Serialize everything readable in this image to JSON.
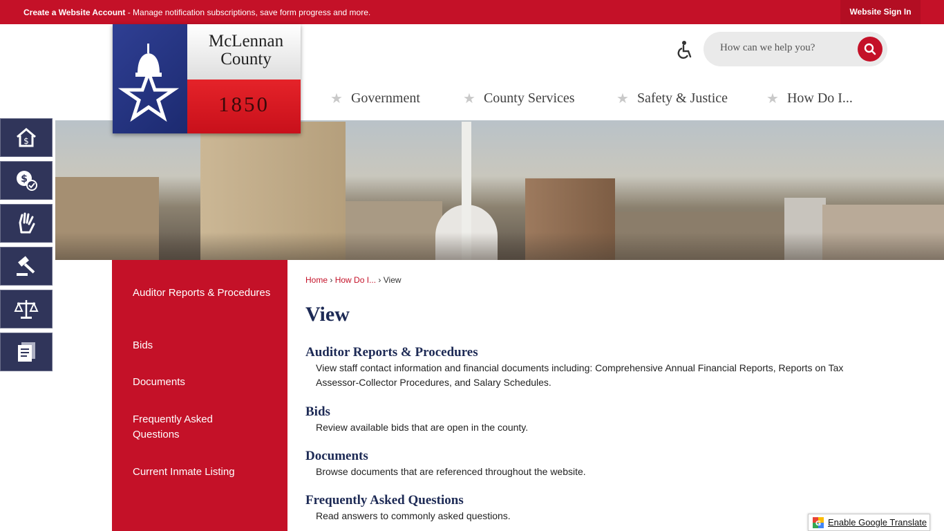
{
  "topbar": {
    "account_link": "Create a Website Account",
    "account_desc": " - Manage notification subscriptions, save form progress and more.",
    "signin": "Website Sign In"
  },
  "logo": {
    "name_line1": "McLennan",
    "name_line2": "County",
    "year": "1850"
  },
  "search": {
    "placeholder": "How can we help you?"
  },
  "nav": [
    "Government",
    "County Services",
    "Safety & Justice",
    "How Do I..."
  ],
  "quick_links_icons": [
    "home-dollar-icon",
    "money-check-icon",
    "helping-hand-icon",
    "gavel-icon",
    "scales-icon",
    "documents-icon"
  ],
  "leftnav": [
    "Auditor Reports & Procedures",
    "Bids",
    "Documents",
    "Frequently Asked Questions",
    "Current Inmate Listing"
  ],
  "breadcrumb": {
    "home": "Home",
    "parent": "How Do I...",
    "current": "View",
    "sep": "›"
  },
  "page_title": "View",
  "entries": [
    {
      "title": "Auditor Reports & Procedures",
      "desc": "View staff contact information and financial documents including: Comprehensive Annual Financial Reports, Reports on Tax Assessor-Collector Procedures, and Salary Schedules."
    },
    {
      "title": "Bids",
      "desc": "Review available bids that are open in the county."
    },
    {
      "title": "Documents",
      "desc": "Browse documents that are referenced throughout the website."
    },
    {
      "title": "Frequently Asked Questions",
      "desc": "Read answers to commonly asked questions."
    }
  ],
  "translate": "Enable Google Translate",
  "colors": {
    "brand_red": "#c41128",
    "navy": "#1d2a55",
    "icon_bg": "#30355a"
  }
}
